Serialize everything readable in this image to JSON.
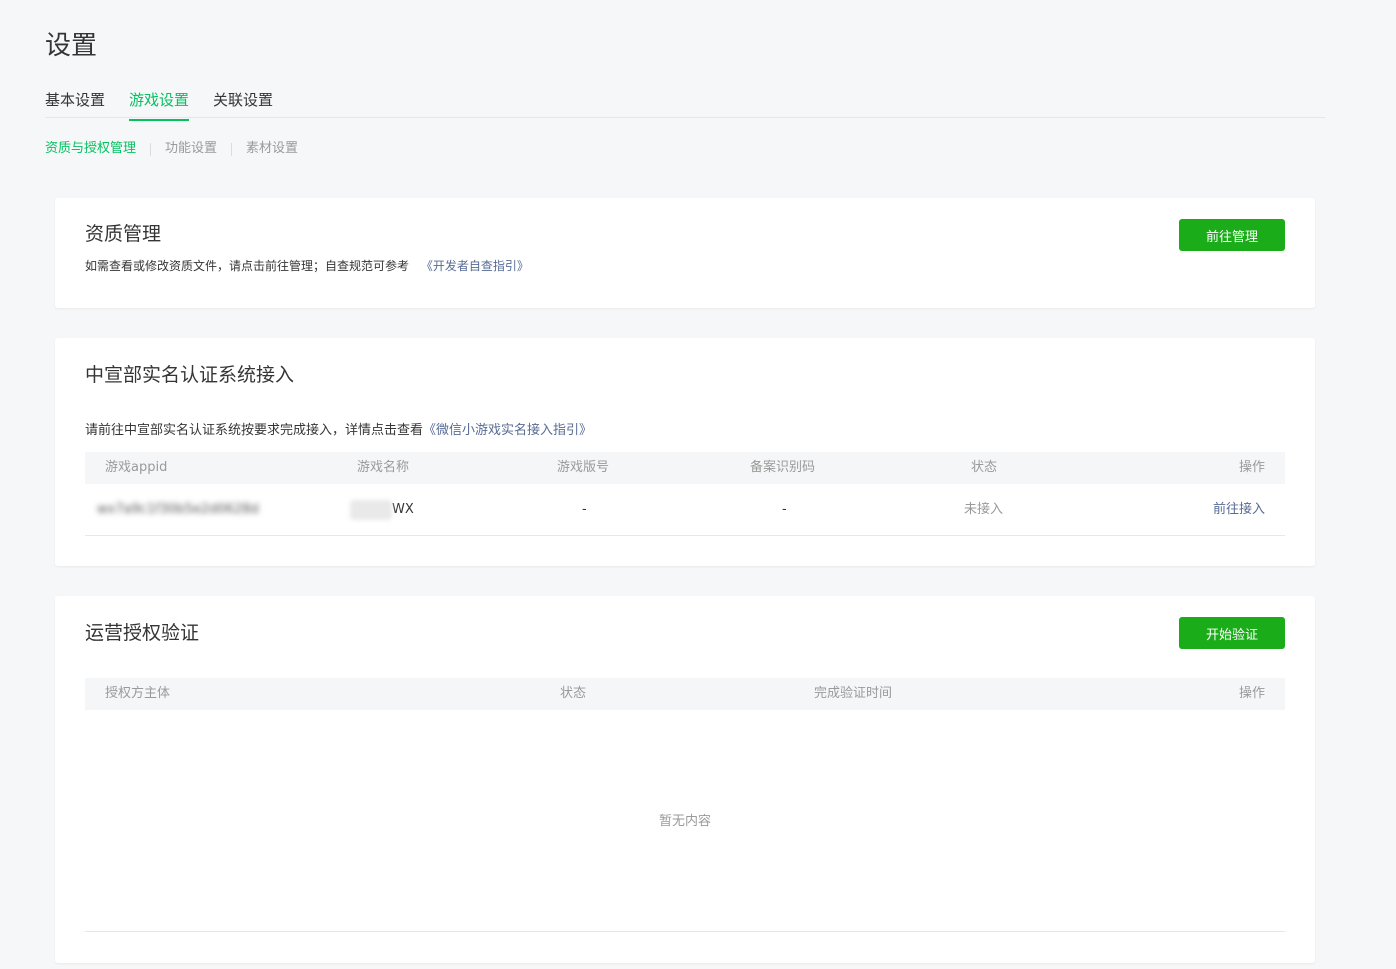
{
  "page": {
    "title": "设置"
  },
  "main_tabs": [
    {
      "label": "基本设置",
      "active": false
    },
    {
      "label": "游戏设置",
      "active": true
    },
    {
      "label": "关联设置",
      "active": false
    }
  ],
  "sub_tabs": [
    {
      "label": "资质与授权管理",
      "active": true
    },
    {
      "label": "功能设置",
      "active": false
    },
    {
      "label": "素材设置",
      "active": false
    }
  ],
  "qualification": {
    "title": "资质管理",
    "desc": "如需查看或修改资质文件，请点击前往管理；自查规范可参考",
    "link": "《开发者自查指引》",
    "button": "前往管理"
  },
  "realname": {
    "title": "中宣部实名认证系统接入",
    "desc": "请前往中宣部实名认证系统按要求完成接入，详情点击查看",
    "link": "《微信小游戏实名接入指引》",
    "columns": [
      "游戏appid",
      "游戏名称",
      "游戏版号",
      "备案识别码",
      "状态",
      "操作"
    ],
    "rows": [
      {
        "appid": "wx7a9c1f30b5e2d0628d",
        "name": "WX",
        "version_no": "-",
        "record_code": "-",
        "status": "未接入",
        "action": "前往接入"
      }
    ]
  },
  "auth": {
    "title": "运营授权验证",
    "button": "开始验证",
    "columns": [
      "授权方主体",
      "状态",
      "完成验证时间",
      "操作"
    ],
    "empty": "暂无内容"
  },
  "colors": {
    "accent": "#07c160",
    "button": "#1aad19",
    "link": "#576b95",
    "muted": "#9a9a9a",
    "background": "#f6f7f9"
  }
}
